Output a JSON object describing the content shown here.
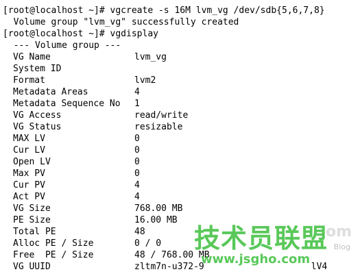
{
  "terminal": {
    "lines": [
      "[root@localhost ~]# vgcreate -s 16M lvm_vg /dev/sdb{5,6,7,8}",
      "  Volume group \"lvm_vg\" successfully created",
      "[root@localhost ~]# vgdisplay",
      "  --- Volume group ---"
    ],
    "vg": {
      "vg_name": {
        "key": "VG Name",
        "value": "lvm_vg"
      },
      "system_id": {
        "key": "System ID",
        "value": ""
      },
      "format": {
        "key": "Format",
        "value": "lvm2"
      },
      "metadata_areas": {
        "key": "Metadata Areas",
        "value": "4"
      },
      "metadata_seq": {
        "key": "Metadata Sequence No",
        "value": "1"
      },
      "vg_access": {
        "key": "VG Access",
        "value": "read/write"
      },
      "vg_status": {
        "key": "VG Status",
        "value": "resizable"
      },
      "max_lv": {
        "key": "MAX LV",
        "value": "0"
      },
      "cur_lv": {
        "key": "Cur LV",
        "value": "0"
      },
      "open_lv": {
        "key": "Open LV",
        "value": "0"
      },
      "max_pv": {
        "key": "Max PV",
        "value": "0"
      },
      "cur_pv": {
        "key": "Cur PV",
        "value": "4"
      },
      "act_pv": {
        "key": "Act PV",
        "value": "4"
      },
      "vg_size": {
        "key": "VG Size",
        "value": "768.00 MB"
      },
      "pe_size": {
        "key": "PE Size",
        "value": "16.00 MB"
      },
      "total_pe": {
        "key": "Total PE",
        "value": "48"
      },
      "alloc_pe": {
        "key": "Alloc PE / Size",
        "value": "0 / 0"
      },
      "free_pe": {
        "key": "Free  PE / Size",
        "value": "48 / 768.00 MB"
      },
      "vg_uuid": {
        "key": "VG UUID",
        "value": "zltm7n-u372-9"
      }
    },
    "uuid_tail": "lV4"
  },
  "watermark": {
    "chinese": "技术员联盟",
    "url": "www.jsgho.com",
    "com": "om",
    "blog": "Blog"
  },
  "colors": {
    "background": "#ffffff",
    "text": "#000000",
    "watermark_green": "#3cbe3c"
  }
}
